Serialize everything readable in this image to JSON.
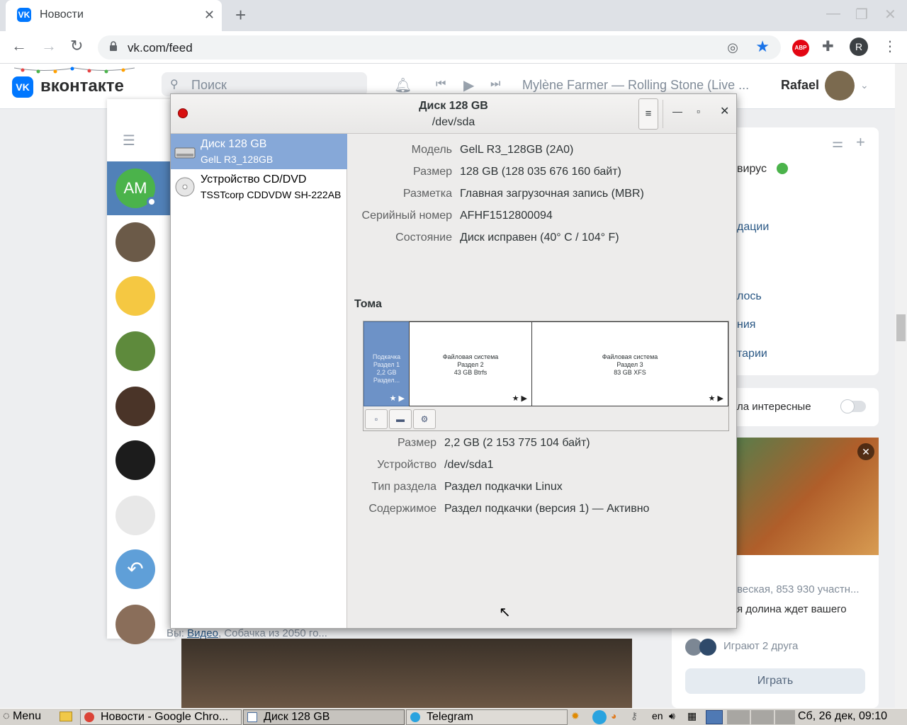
{
  "browser": {
    "tab_title": "Новости",
    "tab_favicon": "VK",
    "url": "vk.com/feed",
    "profile_initial": "R",
    "abp_label": "ABP"
  },
  "vk": {
    "logo_mark": "VK",
    "logo_text": "вконтакте",
    "search_placeholder": "Поиск",
    "now_playing": "Mylène Farmer — Rolling Stone (Live ...",
    "user_name": "Rafael",
    "messenger": {
      "active_initials": "AM",
      "bottom_prefix": "Вы:",
      "bottom_link": "Видео",
      "bottom_rest": "Собачка из 2050 го..."
    },
    "right": {
      "virus_text": "вирус",
      "line2": "дации",
      "line3": "лось",
      "line4": "ния",
      "line5": "тарии",
      "interesting": "ла интересные",
      "community": "веская, 853 930 участн...",
      "game_desc": "я долина ждет вашего",
      "friends_playing": "Играют 2 друга",
      "play_button": "Играть"
    }
  },
  "disks": {
    "title": "Диск 128 GB",
    "subtitle": "/dev/sda",
    "devices": [
      {
        "name": "Диск 128 GB",
        "detail": "GelL R3_128GB"
      },
      {
        "name": "Устройство CD/DVD",
        "detail": "TSSTcorp CDDVDW SH-222AB"
      }
    ],
    "disk_props": [
      {
        "label": "Модель",
        "value": "GelL R3_128GB (2A0)"
      },
      {
        "label": "Размер",
        "value": "128 GB (128 035 676 160 байт)"
      },
      {
        "label": "Разметка",
        "value": "Главная загрузочная запись (MBR)"
      },
      {
        "label": "Серийный номер",
        "value": "AFHF1512800094"
      },
      {
        "label": "Состояние",
        "value": "Диск исправен (40° C / 104° F)"
      }
    ],
    "volumes_heading": "Тома",
    "volumes": [
      {
        "line1": "Подкачка",
        "line2": "Раздел 1",
        "line3": "2,2 GB Раздел..."
      },
      {
        "line1": "Файловая система",
        "line2": "Раздел 2",
        "line3": "43 GB Btrfs"
      },
      {
        "line1": "Файловая система",
        "line2": "Раздел 3",
        "line3": "83 GB XFS"
      }
    ],
    "partition_props": [
      {
        "label": "Размер",
        "value": "2,2 GB (2 153 775 104 байт)"
      },
      {
        "label": "Устройство",
        "value": "/dev/sda1"
      },
      {
        "label": "Тип раздела",
        "value": "Раздел подкачки Linux"
      },
      {
        "label": "Содержимое",
        "value": "Раздел подкачки (версия 1) — Активно"
      }
    ]
  },
  "taskbar": {
    "menu_label": "Menu",
    "tasks": [
      {
        "label": "Новости - Google Chro..."
      },
      {
        "label": "Диск 128 GB"
      },
      {
        "label": "Telegram"
      }
    ],
    "keyboard_layout": "en",
    "clock": "Сб, 26 дек, 09:10"
  }
}
